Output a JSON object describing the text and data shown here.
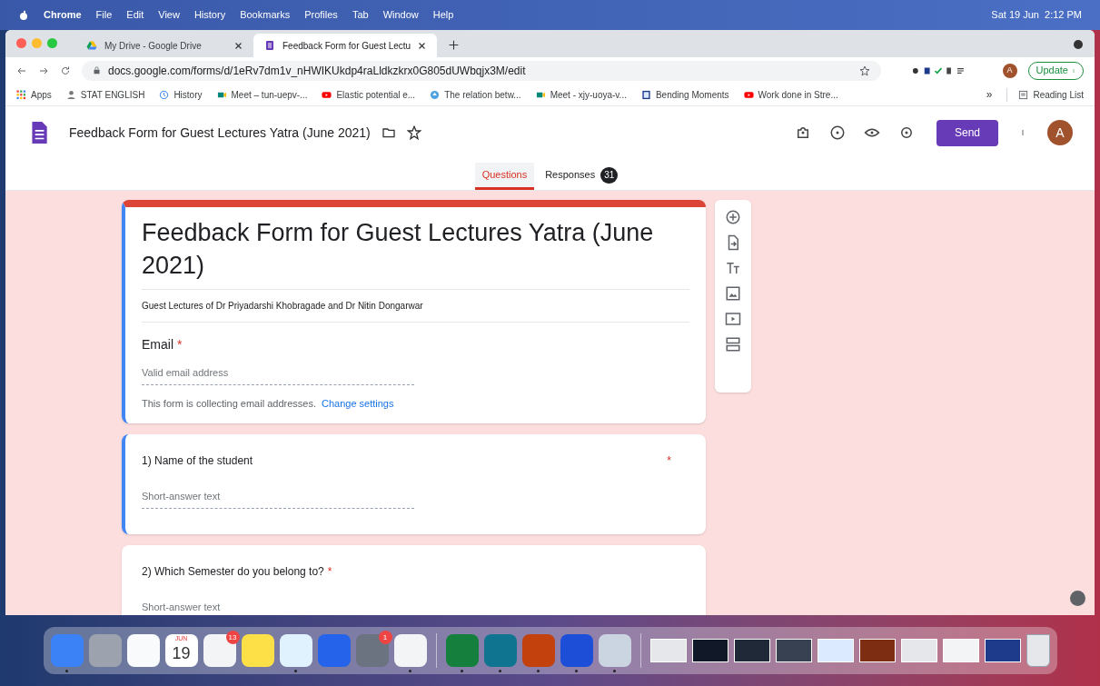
{
  "menubar": {
    "app": "Chrome",
    "menus": [
      "File",
      "Edit",
      "View",
      "History",
      "Bookmarks",
      "Profiles",
      "Tab",
      "Window",
      "Help"
    ],
    "clock": "Sat 19 Jun  2:12 PM"
  },
  "browser_tabs": [
    {
      "title": "My Drive - Google Drive",
      "selected": false,
      "kind": "drive"
    },
    {
      "title": "Feedback Form for Guest Lectu",
      "selected": true,
      "kind": "forms"
    }
  ],
  "url": "docs.google.com/forms/d/1eRv7dm1v_nHWIKUkdp4raLldkzkrx0G805dUWbqjx3M/edit",
  "profile": "A",
  "update_button": "Update",
  "bookmarks": [
    {
      "label": "Apps",
      "kind": "apps"
    },
    {
      "label": "STAT ENGLISH",
      "kind": "person"
    },
    {
      "label": "History",
      "kind": "history"
    },
    {
      "label": "Meet – tun-uepv-...",
      "kind": "meet"
    },
    {
      "label": "Elastic potential e...",
      "kind": "youtube"
    },
    {
      "label": "The relation betw...",
      "kind": "globe"
    },
    {
      "label": "Meet - xjy-uoya-v...",
      "kind": "meet"
    },
    {
      "label": "Bending Moments",
      "kind": "doc"
    },
    {
      "label": "Work done in Stre...",
      "kind": "youtube"
    }
  ],
  "bookmarks_more": "»",
  "reading_list": "Reading List",
  "forms_header": {
    "title": "Feedback Form for Guest Lectures Yatra (June 2021)",
    "send": "Send",
    "avatar": "A",
    "tabs": [
      {
        "label": "Questions",
        "selected": true
      },
      {
        "label": "Responses",
        "selected": false,
        "count": "31"
      }
    ]
  },
  "form": {
    "title": "Feedback Form for Guest Lectures Yatra (June 2021)",
    "description": "Guest Lectures of Dr Priyadarshi Khobragade and Dr Nitin Dongarwar",
    "email": {
      "label": "Email",
      "required_mark": "*",
      "placeholder": "Valid email address",
      "note": "This form is collecting email addresses.",
      "link": "Change settings"
    },
    "questions": [
      {
        "label": "1) Name of the student",
        "required_mark": "*",
        "selected": true,
        "placeholder": "Short-answer text"
      },
      {
        "label": "2) Which Semester do you belong to?",
        "required_mark": "*",
        "selected": false,
        "placeholder": "Short-answer text"
      }
    ]
  },
  "dock": [
    {
      "kind": "app",
      "color": "#3b82f6",
      "running": true
    },
    {
      "kind": "app",
      "color": "#9ca3af",
      "running": false
    },
    {
      "kind": "app",
      "color": "#f9fafb",
      "running": false
    },
    {
      "kind": "calendar",
      "month": "JUN",
      "day": "19",
      "running": false
    },
    {
      "kind": "app",
      "color": "#f3f4f6",
      "badge": "13",
      "running": false
    },
    {
      "kind": "app",
      "color": "#fde047",
      "running": false
    },
    {
      "kind": "app",
      "color": "#e0f2fe",
      "running": true
    },
    {
      "kind": "app",
      "color": "#2563eb",
      "running": false
    },
    {
      "kind": "app",
      "color": "#6b7280",
      "badge": "1",
      "running": false
    },
    {
      "kind": "app",
      "color": "#f3f4f6",
      "running": true
    },
    {
      "kind": "divider"
    },
    {
      "kind": "app",
      "color": "#15803d",
      "running": true
    },
    {
      "kind": "app",
      "color": "#0e7490",
      "running": true
    },
    {
      "kind": "app",
      "color": "#c2410c",
      "running": true
    },
    {
      "kind": "app",
      "color": "#1d4ed8",
      "running": true
    },
    {
      "kind": "app",
      "color": "#cbd5e1",
      "running": true
    },
    {
      "kind": "divider"
    },
    {
      "kind": "window",
      "color": "#e5e7eb"
    },
    {
      "kind": "window",
      "color": "#111827"
    },
    {
      "kind": "window",
      "color": "#1f2937"
    },
    {
      "kind": "window",
      "color": "#374151"
    },
    {
      "kind": "window",
      "color": "#dbeafe"
    },
    {
      "kind": "window",
      "color": "#7c2d12"
    },
    {
      "kind": "window",
      "color": "#e5e7eb"
    },
    {
      "kind": "window",
      "color": "#f3f4f6"
    },
    {
      "kind": "window",
      "color": "#1e3a8a"
    },
    {
      "kind": "trash",
      "color": "#e5e7eb"
    }
  ]
}
